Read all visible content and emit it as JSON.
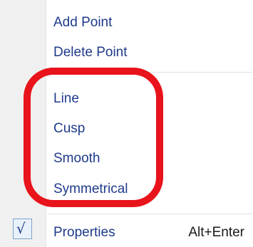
{
  "menu": {
    "items": [
      {
        "label": "Add Point"
      },
      {
        "label": "Delete Point"
      },
      {
        "label": "Line"
      },
      {
        "label": "Cusp"
      },
      {
        "label": "Smooth"
      },
      {
        "label": "Symmetrical"
      },
      {
        "label": "Properties",
        "shortcut": "Alt+Enter",
        "checked": true
      }
    ],
    "check_glyph": "√"
  },
  "annotation": {
    "highlight_color": "#e8131b",
    "highlighted_items": [
      "Line",
      "Cusp",
      "Smooth",
      "Symmetrical"
    ]
  }
}
